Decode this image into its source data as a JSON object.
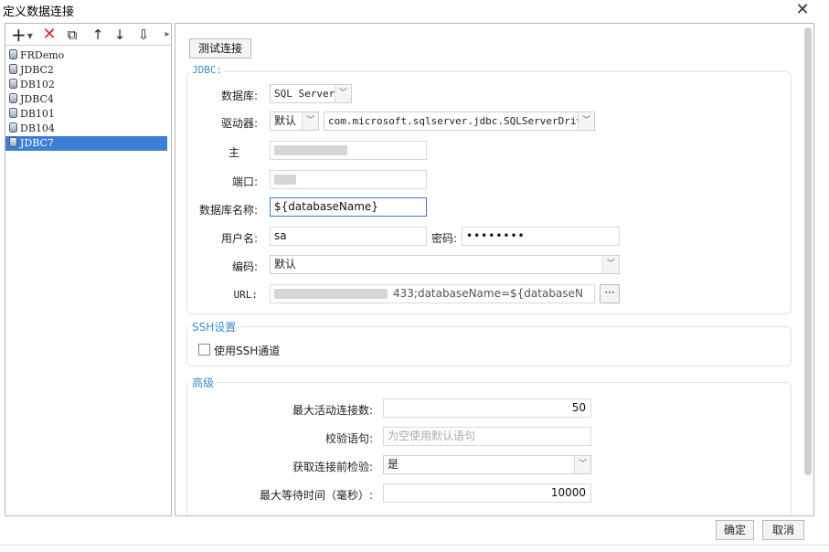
{
  "window": {
    "title": "定义数据连接",
    "close_glyph": "✕"
  },
  "toolbar": {
    "add": "+",
    "delete": "✕",
    "copy": "⧉",
    "up": "↑",
    "down": "↓",
    "sort": "⇩"
  },
  "connections": [
    "FRDemo",
    "JDBC2",
    "DB102",
    "JDBC4",
    "DB101",
    "DB104",
    "JDBC7"
  ],
  "selected_connection": "JDBC7",
  "test_button": "测试连接",
  "jdbc": {
    "section_title": "JDBC:",
    "database_label": "数据库:",
    "database_value": "SQL Server",
    "driver_label": "驱动器:",
    "driver_mode": "默认",
    "driver_class": "com.microsoft.sqlserver.jdbc.SQLServerDriver",
    "host_label": "主",
    "port_label": "端口:",
    "dbname_label": "数据库名称:",
    "dbname_value": "${databaseName}",
    "user_label": "用户名:",
    "user_value": "sa",
    "password_label": "密码:",
    "password_value": "••••••••",
    "encoding_label": "编码:",
    "encoding_value": "默认",
    "url_label": "URL:",
    "url_visible": "433;databaseName=${databaseN",
    "url_more": "···"
  },
  "ssh": {
    "section_title": "SSH设置",
    "use_ssh_label": "使用SSH通道"
  },
  "advanced": {
    "section_title": "高级",
    "max_active_label": "最大活动连接数:",
    "max_active_value": "50",
    "validation_label": "校验语句:",
    "validation_placeholder": "为空使用默认语句",
    "test_on_borrow_label": "获取连接前检验:",
    "test_on_borrow_value": "是",
    "max_wait_label": "最大等待时间（毫秒）:",
    "max_wait_value": "10000"
  },
  "footer": {
    "ok": "确定",
    "cancel": "取消"
  }
}
